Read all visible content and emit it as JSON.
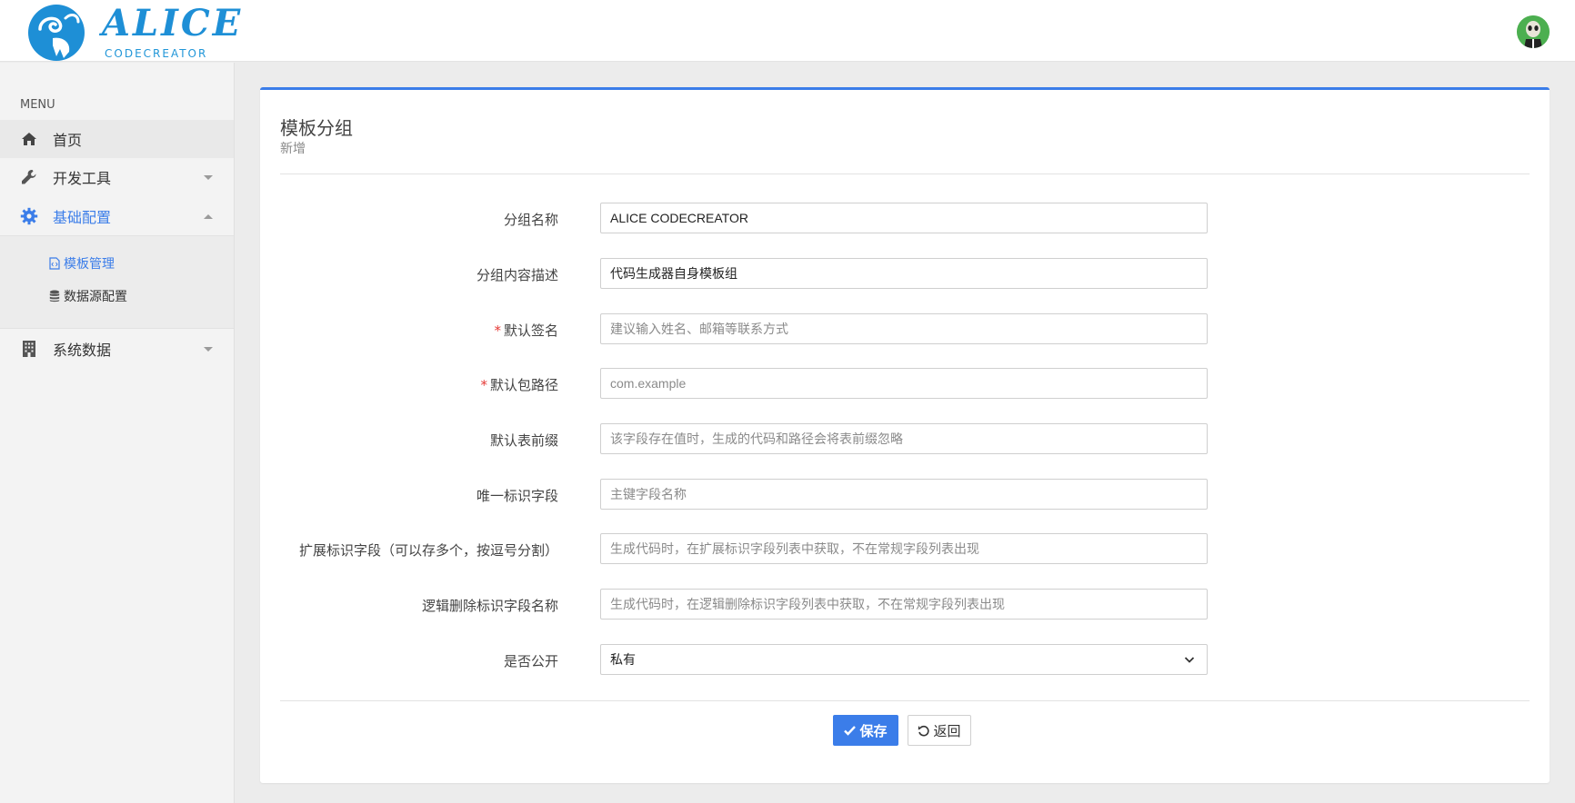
{
  "header": {
    "logo_title": "ALICE",
    "logo_subtitle": "CODECREATOR",
    "avatar_icon": "user-avatar-icon"
  },
  "sidebar": {
    "menu_header": "MENU",
    "items": [
      {
        "label": "首页",
        "icon": "home-icon"
      },
      {
        "label": "开发工具",
        "icon": "wrench-icon"
      },
      {
        "label": "基础配置",
        "icon": "gear-icon"
      },
      {
        "label": "系统数据",
        "icon": "building-icon"
      }
    ],
    "submenu": [
      {
        "label": "模板管理",
        "icon": "code-file-icon"
      },
      {
        "label": "数据源配置",
        "icon": "database-icon"
      }
    ]
  },
  "panel": {
    "title": "模板分组",
    "subtitle": "新增"
  },
  "form": {
    "fields": [
      {
        "label": "分组名称",
        "required": false,
        "value": "ALICE CODECREATOR",
        "placeholder": ""
      },
      {
        "label": "分组内容描述",
        "required": false,
        "value": "代码生成器自身模板组",
        "placeholder": ""
      },
      {
        "label": "默认签名",
        "required": true,
        "value": "",
        "placeholder": "建议输入姓名、邮箱等联系方式"
      },
      {
        "label": "默认包路径",
        "required": true,
        "value": "",
        "placeholder": "com.example"
      },
      {
        "label": "默认表前缀",
        "required": false,
        "value": "",
        "placeholder": "该字段存在值时，生成的代码和路径会将表前缀忽略"
      },
      {
        "label": "唯一标识字段",
        "required": false,
        "value": "",
        "placeholder": "主键字段名称"
      },
      {
        "label": "扩展标识字段（可以存多个，按逗号分割）",
        "required": false,
        "value": "",
        "placeholder": "生成代码时，在扩展标识字段列表中获取，不在常规字段列表出现"
      },
      {
        "label": "逻辑删除标识字段名称",
        "required": false,
        "value": "",
        "placeholder": "生成代码时，在逻辑删除标识字段列表中获取，不在常规字段列表出现"
      }
    ],
    "public_select": {
      "label": "是否公开",
      "value": "私有"
    },
    "required_mark": "*"
  },
  "buttons": {
    "save_label": "保存",
    "back_label": "返回"
  },
  "colors": {
    "accent": "#3b7de9",
    "required": "#e53935",
    "logo": "#1e8fd6"
  }
}
